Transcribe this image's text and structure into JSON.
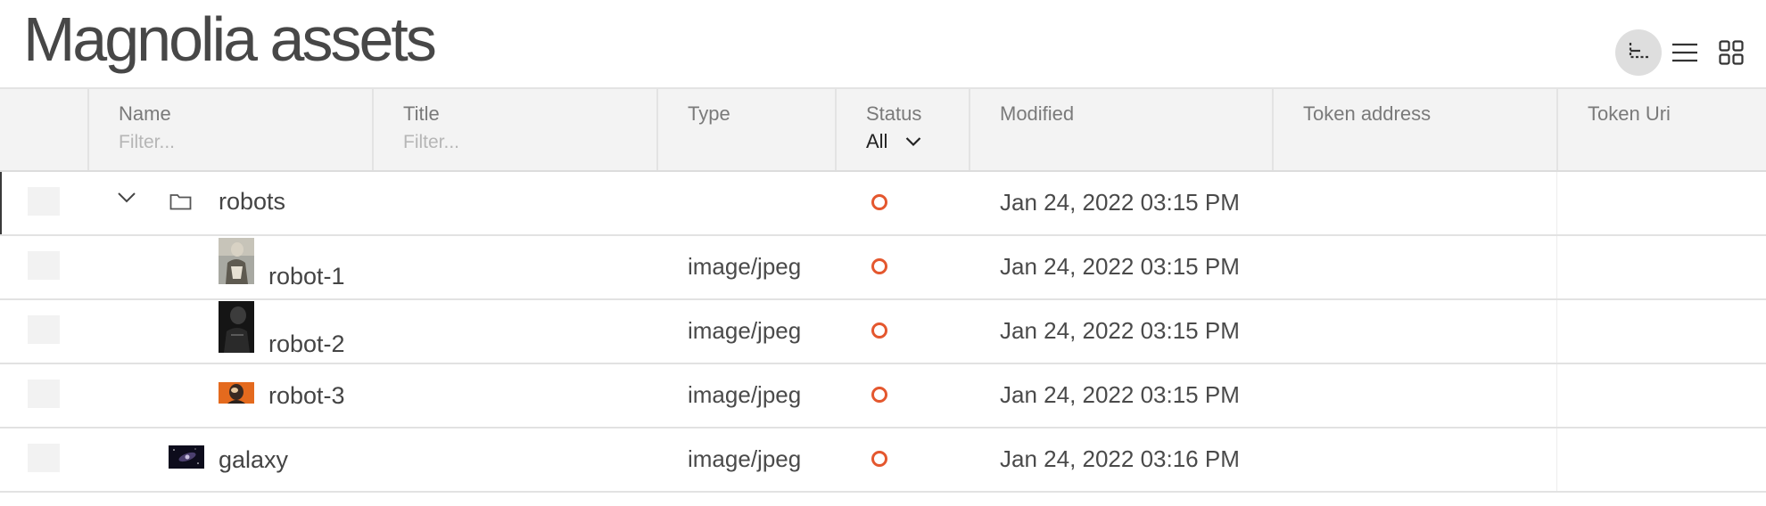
{
  "page": {
    "title": "Magnolia assets"
  },
  "view_switch": [
    {
      "name": "tree-view",
      "active": true
    },
    {
      "name": "list-view",
      "active": false
    },
    {
      "name": "thumbnail-view",
      "active": false
    }
  ],
  "columns": {
    "name": {
      "label": "Name",
      "filter_placeholder": "Filter..."
    },
    "title": {
      "label": "Title",
      "filter_placeholder": "Filter..."
    },
    "type": {
      "label": "Type"
    },
    "status": {
      "label": "Status",
      "selected": "All"
    },
    "modified": {
      "label": "Modified"
    },
    "token_address": {
      "label": "Token address"
    },
    "token_uri": {
      "label": "Token Uri"
    }
  },
  "rows": [
    {
      "name": "robots",
      "type": "",
      "modified": "Jan 24, 2022 03:15 PM",
      "kind": "folder",
      "expanded": true
    },
    {
      "name": "robot-1",
      "type": "image/jpeg",
      "modified": "Jan 24, 2022 03:15 PM",
      "kind": "image"
    },
    {
      "name": "robot-2",
      "type": "image/jpeg",
      "modified": "Jan 24, 2022 03:15 PM",
      "kind": "image"
    },
    {
      "name": "robot-3",
      "type": "image/jpeg",
      "modified": "Jan 24, 2022 03:15 PM",
      "kind": "image"
    },
    {
      "name": "galaxy",
      "type": "image/jpeg",
      "modified": "Jan 24, 2022 03:16 PM",
      "kind": "image"
    }
  ],
  "colors": {
    "status_dot": "#e4572e",
    "header_bg": "#f3f3f3"
  }
}
